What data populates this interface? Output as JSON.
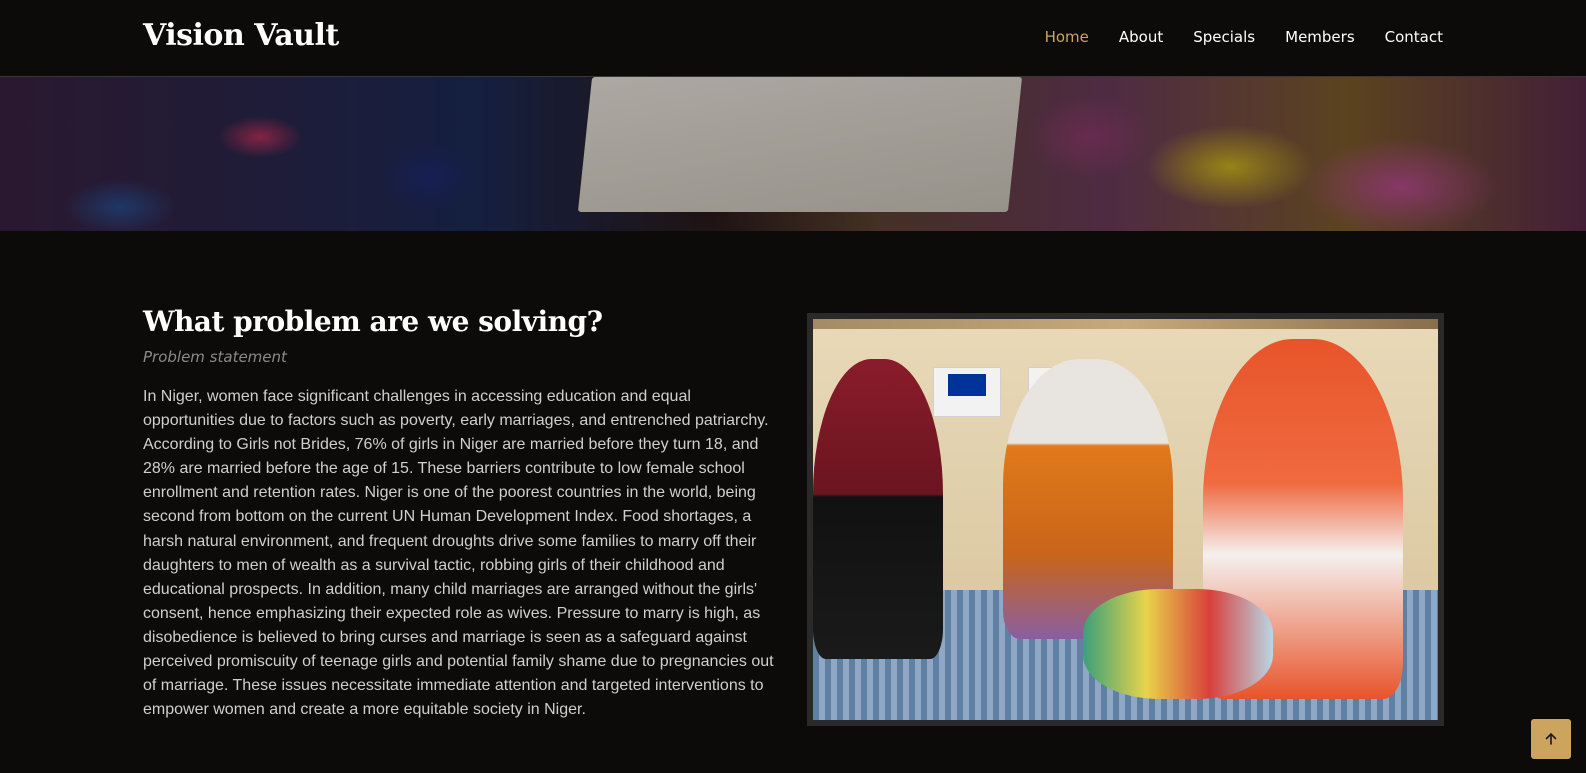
{
  "header": {
    "logo": "Vision Vault",
    "nav": [
      {
        "label": "Home",
        "active": true
      },
      {
        "label": "About",
        "active": false
      },
      {
        "label": "Specials",
        "active": false
      },
      {
        "label": "Members",
        "active": false
      },
      {
        "label": "Contact",
        "active": false
      }
    ]
  },
  "section": {
    "title": "What problem are we solving?",
    "subtitle": "Problem statement",
    "body": "In Niger, women face significant challenges in accessing education and equal opportunities due to factors such as poverty, early marriages, and entrenched patriarchy. According to Girls not Brides, 76% of girls in Niger are married before they turn 18, and 28% are married before the age of 15. These barriers contribute to low female school enrollment and retention rates. Niger is one of the poorest countries in the world, being second from bottom on the current UN Human Development Index. Food shortages, a harsh natural environment, and frequent droughts drive some families to marry off their daughters to men of wealth as a survival tactic, robbing girls of their childhood and educational prospects. In addition, many child marriages are arranged without the girls' consent, hence emphasizing their expected role as wives. Pressure to marry is high, as disobedience is believed to bring curses and marriage is seen as a safeguard against perceived promiscuity of teenage girls and potential family shame due to pregnancies out of marriage. These issues necessitate immediate attention and targeted interventions to empower women and create a more equitable society in Niger."
  },
  "colors": {
    "accent": "#cda45e",
    "background": "#0c0b09",
    "text": "#cfcfcf"
  },
  "icons": {
    "scroll_top": "arrow-up-icon"
  }
}
